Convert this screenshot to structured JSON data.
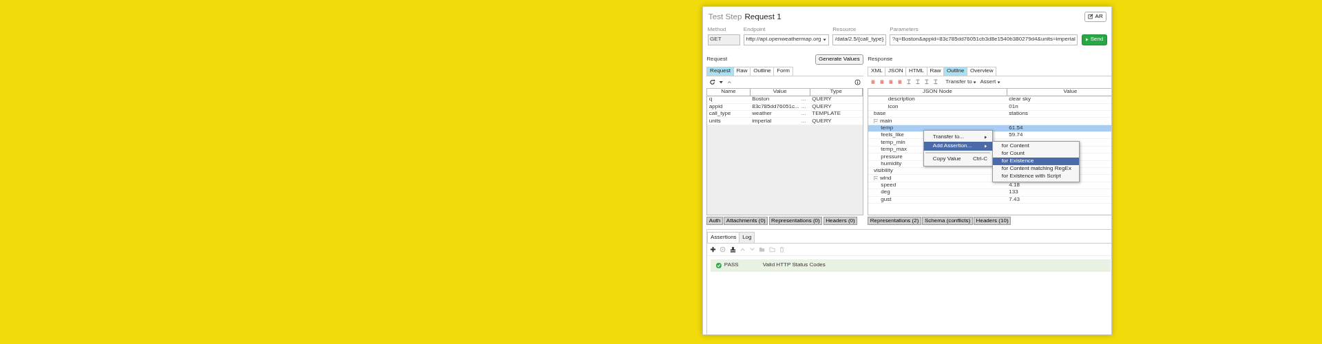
{
  "window": {
    "title_prefix": "Test Step",
    "title": "Request 1",
    "edit_button": "AR"
  },
  "fields": [
    {
      "label": "Method",
      "value": "GET",
      "kind": "text"
    },
    {
      "label": "Endpoint",
      "value": "http://api.openweathermap.org",
      "kind": "dropdown"
    },
    {
      "label": "Resource",
      "value": "/data/2.5/{call_type}",
      "kind": "text"
    },
    {
      "label": "Parameters",
      "value": "?q=Boston&appid=83c785dd76051cb3d8e1540b380279d4&units=imperial",
      "kind": "text"
    }
  ],
  "send_button": "Send",
  "request": {
    "title": "Request",
    "generate_button": "Generate Values",
    "tabs": [
      {
        "label": "Request",
        "selected": true
      },
      {
        "label": "Raw",
        "selected": false
      },
      {
        "label": "Outline",
        "selected": false
      },
      {
        "label": "Form",
        "selected": false
      }
    ],
    "columns": [
      "Name",
      "Value",
      "Type"
    ],
    "rows": [
      {
        "name": "q",
        "value": "Boston",
        "more": "...",
        "type": "QUERY"
      },
      {
        "name": "appid",
        "value": "83c785dd76051c...",
        "more": "...",
        "type": "QUERY"
      },
      {
        "name": "call_type",
        "value": "weather",
        "more": "...",
        "type": "TEMPLATE"
      },
      {
        "name": "units",
        "value": "imperial",
        "more": "...",
        "type": "QUERY"
      }
    ],
    "bottom_tabs": [
      "Auth",
      "Attachments (0)",
      "Representations (0)",
      "Headers (0)"
    ]
  },
  "response": {
    "title": "Response",
    "tabs": [
      {
        "label": "XML",
        "selected": false
      },
      {
        "label": "JSON",
        "selected": false
      },
      {
        "label": "HTML",
        "selected": false
      },
      {
        "label": "Raw",
        "selected": false
      },
      {
        "label": "Outline",
        "selected": true
      },
      {
        "label": "Overview",
        "selected": false
      }
    ],
    "transfer_menu": "Transfer to",
    "assert_menu": "Assert",
    "columns": [
      "JSON Node",
      "Value"
    ],
    "continued": [
      {
        "name": "description",
        "value": "clear sky",
        "selected": false
      },
      {
        "name": "icon",
        "value": "01n",
        "selected": false
      }
    ],
    "nodes": [
      {
        "name": "base",
        "value": "stations",
        "selected": false
      },
      {
        "name": "main",
        "selected": false,
        "expanded": true,
        "children": [
          {
            "name": "temp",
            "value": "61.54",
            "selected": true
          },
          {
            "name": "feels_like",
            "value": "59.74",
            "selected": false
          },
          {
            "name": "temp_min",
            "selected": false
          },
          {
            "name": "temp_max",
            "selected": false
          },
          {
            "name": "pressure",
            "selected": false
          },
          {
            "name": "humidity",
            "selected": false
          }
        ]
      },
      {
        "name": "visibility",
        "selected": false
      },
      {
        "name": "wind",
        "selected": false,
        "expanded": true,
        "children": [
          {
            "name": "speed",
            "value": "4.18",
            "selected": false
          },
          {
            "name": "deg",
            "value": "133",
            "selected": false
          },
          {
            "name": "gust",
            "value": "7.43",
            "selected": false
          }
        ]
      }
    ],
    "bottom_tabs": [
      "Representations (2)",
      "Schema (conflicts)",
      "Headers (10)"
    ]
  },
  "context_menu": {
    "items": [
      {
        "label": "Transfer to...",
        "kind": "submenu",
        "selected": false
      },
      {
        "label": "Add Assertion...",
        "kind": "submenu",
        "selected": true
      },
      {
        "label": "Copy Value",
        "shortcut": "Ctrl-C",
        "kind": "action",
        "selected": false
      }
    ],
    "submenu": [
      {
        "label": "for Content",
        "selected": false
      },
      {
        "label": "for Count",
        "selected": false
      },
      {
        "label": "for Existence",
        "selected": true
      },
      {
        "label": "for Content matching RegEx",
        "selected": false
      },
      {
        "label": "for Existence with Script",
        "selected": false
      }
    ]
  },
  "assertions": {
    "tabs": [
      {
        "label": "Assertions",
        "selected": true
      },
      {
        "label": "Log",
        "selected": false
      }
    ],
    "tools": [
      {
        "kind": "add",
        "disabled": false
      },
      {
        "kind": "configure",
        "disabled": true
      },
      {
        "kind": "stamp",
        "disabled": false
      },
      {
        "kind": "up",
        "disabled": true
      },
      {
        "kind": "down",
        "disabled": true
      },
      {
        "kind": "folder",
        "disabled": true
      },
      {
        "kind": "folder-open",
        "disabled": true
      },
      {
        "kind": "delete",
        "disabled": true
      }
    ],
    "rows": [
      {
        "status": "PASS",
        "name": "Valid HTTP Status Codes",
        "passed": true
      }
    ]
  }
}
